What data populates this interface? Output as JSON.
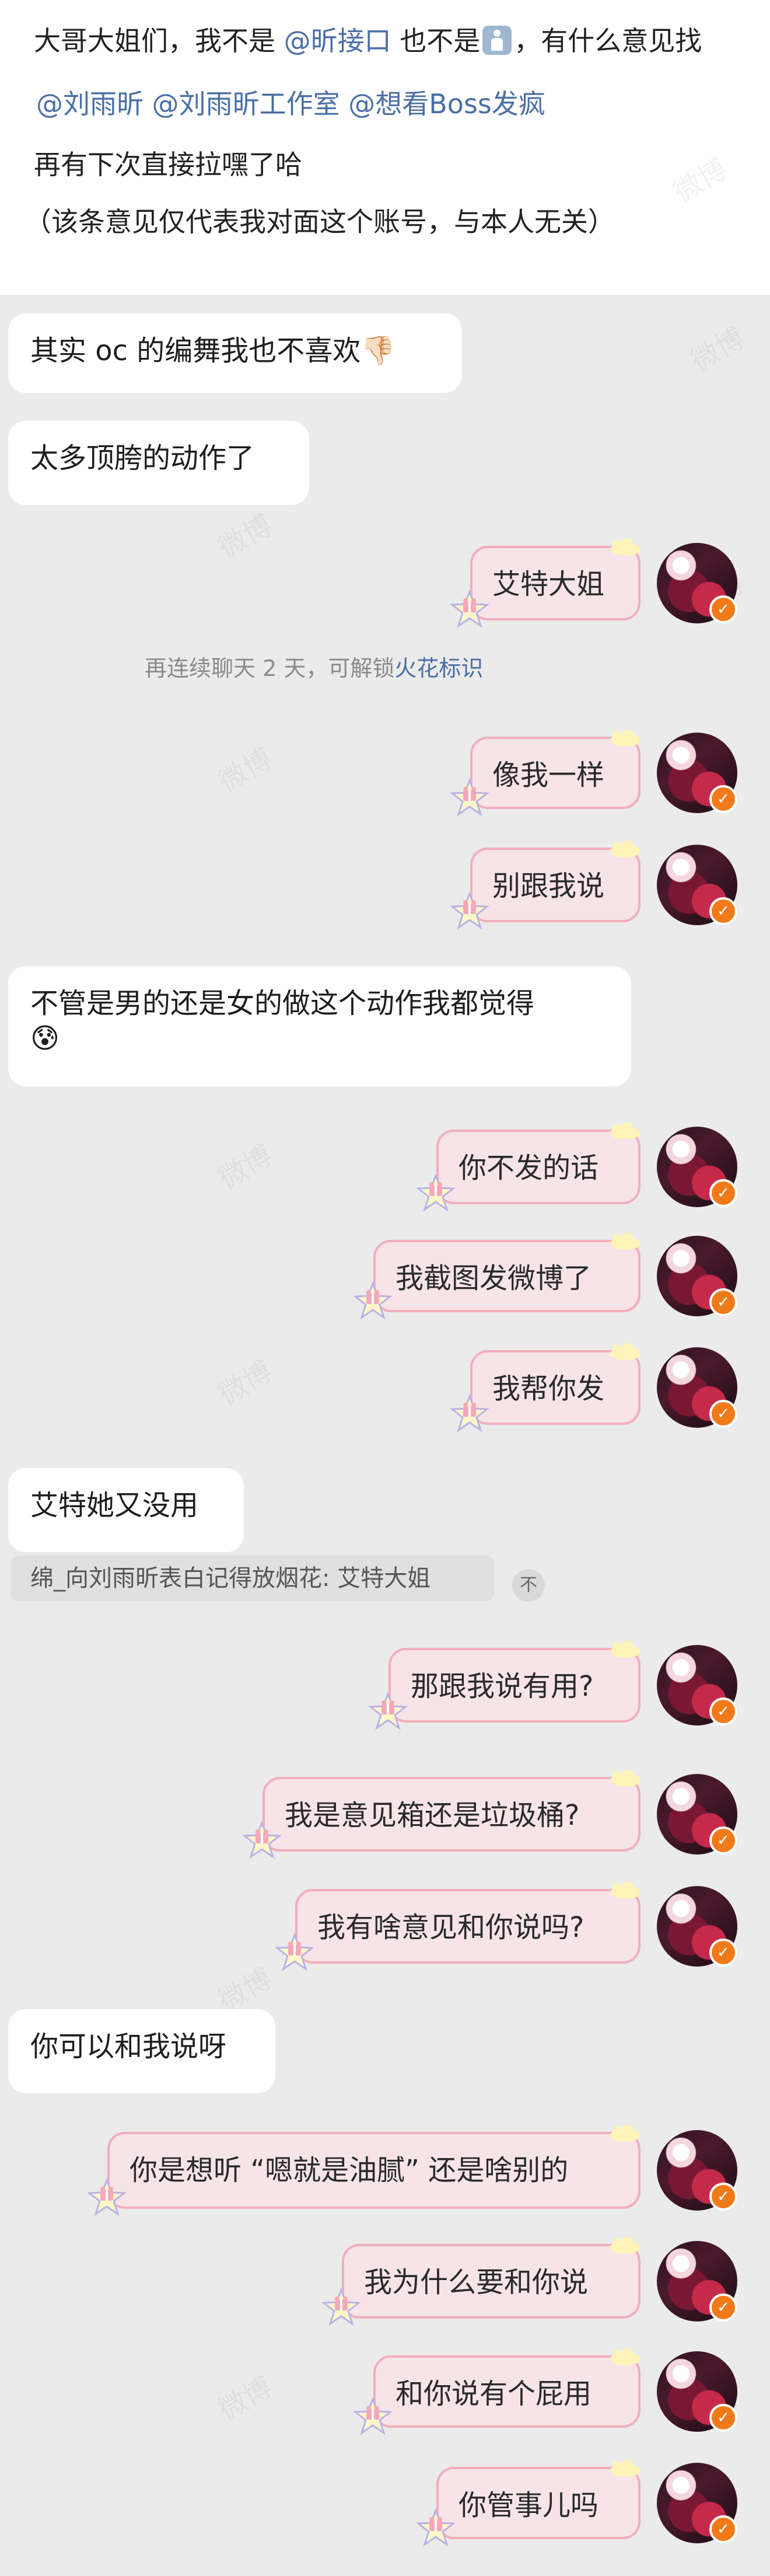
{
  "post": {
    "line1_a": "大哥大姐们，我不是 ",
    "mention1": "@昕接口",
    "line1_b": " 也不是",
    "line1_c": "，有什么意见找",
    "mention2": "@刘雨昕",
    "mention3": "@刘雨昕工作室",
    "mention4": "@想看Boss发疯",
    "line3": "再有下次直接拉嘿了哈",
    "line4": "（该条意见仅代表我对面这个账号，与本人无关）"
  },
  "notice": {
    "text": "再连续聊天 2 天，可解锁",
    "link": "火花标识"
  },
  "quote": {
    "text": "绵_向刘雨昕表白记得放烟花: 艾特大姐",
    "button": "不"
  },
  "messages": [
    {
      "side": "left",
      "text": "其实 oc 的编舞我也不喜欢",
      "emoji": "👎🏻"
    },
    {
      "side": "left",
      "text": "太多顶胯的动作了"
    },
    {
      "side": "right",
      "text": "艾特大姐"
    },
    {
      "side": "right",
      "text": "像我一样"
    },
    {
      "side": "right",
      "text": "别跟我说"
    },
    {
      "side": "left",
      "text": "不管是男的还是女的做这个动作我都觉得",
      "emoji": "😰"
    },
    {
      "side": "right",
      "text": "你不发的话"
    },
    {
      "side": "right",
      "text": "我截图发微博了"
    },
    {
      "side": "right",
      "text": "我帮你发"
    },
    {
      "side": "left",
      "text": "艾特她又没用"
    },
    {
      "side": "right",
      "text": "那跟我说有用?"
    },
    {
      "side": "right",
      "text": "我是意见箱还是垃圾桶?"
    },
    {
      "side": "right",
      "text": "我有啥意见和你说吗?"
    },
    {
      "side": "left",
      "text": "你可以和我说呀"
    },
    {
      "side": "right",
      "text": "你是想听 “嗯就是油腻” 还是啥别的"
    },
    {
      "side": "right",
      "text": "我为什么要和你说"
    },
    {
      "side": "right",
      "text": "和你说有个屁用"
    },
    {
      "side": "right",
      "text": "你管事儿吗"
    }
  ],
  "colors": {
    "background": "#ebebeb",
    "bubble_right": "#f6e4e8",
    "bubble_right_border": "#f2aebe",
    "mention": "#4a6fa5",
    "verified_badge": "#f07a1a"
  },
  "icons": {
    "person": "person-standing-icon",
    "verified": "verified-badge-icon",
    "bubble_deco": "star-gift-icon"
  },
  "watermark": "微博"
}
